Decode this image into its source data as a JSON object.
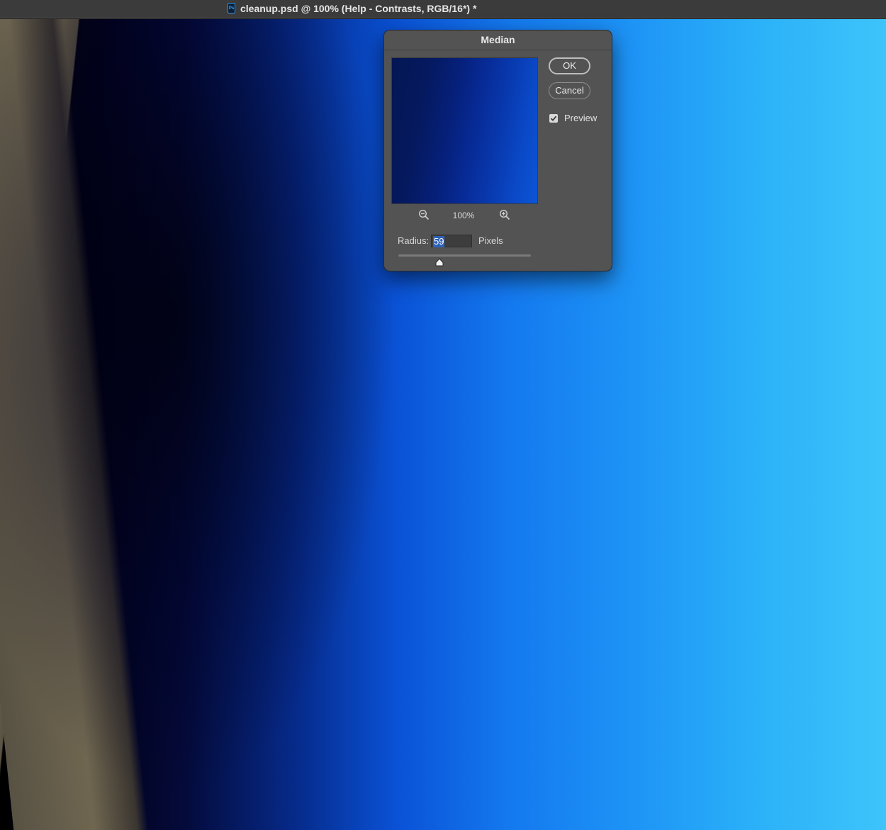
{
  "window": {
    "app_icon": "photoshop-icon",
    "app_icon_text": "Ps",
    "title": "cleanup.psd @ 100% (Help - Contrasts, RGB/16*) *"
  },
  "dialog": {
    "title": "Median",
    "ok_label": "OK",
    "cancel_label": "Cancel",
    "preview_label": "Preview",
    "preview_checked": true,
    "zoom_level": "100%",
    "zoom_out_icon": "zoom-out-icon",
    "zoom_in_icon": "zoom-in-icon",
    "radius_label": "Radius:",
    "radius_value": "59",
    "radius_unit": "Pixels",
    "slider_fraction": 0.31
  },
  "colors": {
    "dialog_bg": "#535353",
    "titlebar_bg": "#3b3b3b",
    "selection": "#2e62b8"
  }
}
